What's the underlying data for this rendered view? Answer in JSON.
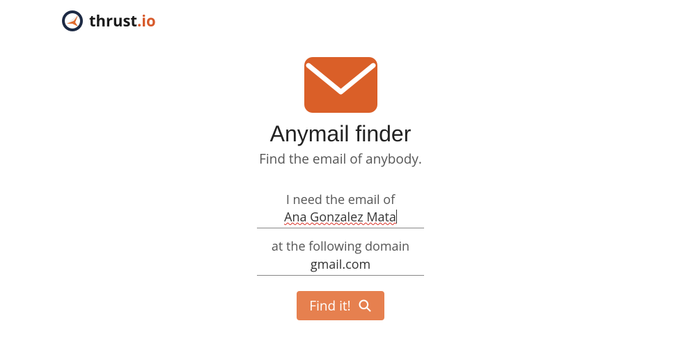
{
  "header": {
    "brand_main": "thrust",
    "brand_suffix": ".io"
  },
  "main": {
    "title": "Anymail finder",
    "subtitle": "Find the email of anybody."
  },
  "form": {
    "name_label": "I need the email of",
    "name_value": "Ana Gonzalez Mata",
    "domain_label": "at the following domain",
    "domain_value": "gmail.com",
    "button_label": "Find it!"
  },
  "colors": {
    "accent": "#d75a2b",
    "button": "#e6804f"
  }
}
